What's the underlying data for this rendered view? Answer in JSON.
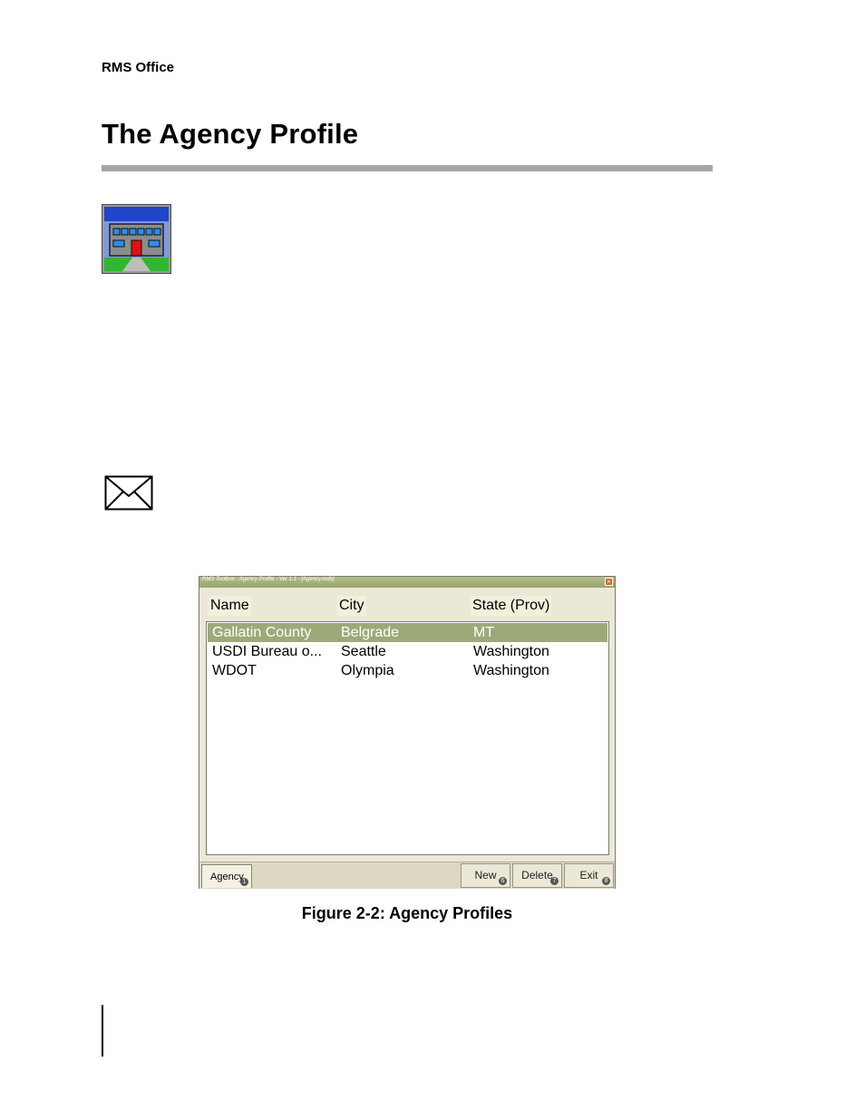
{
  "header": {
    "section": "RMS Office"
  },
  "page": {
    "title": "The Agency Profile"
  },
  "icons": {
    "agency": "building-icon",
    "note": "envelope-icon"
  },
  "window": {
    "title": "RMS Toolbox - Agency Profile - Ver 1.1 - [Agency.mdb]",
    "columns": [
      "Name",
      "City",
      "State (Prov)"
    ],
    "rows": [
      {
        "name": "Gallatin County",
        "city": "Belgrade",
        "state": "MT",
        "selected": true
      },
      {
        "name": "USDI Bureau o...",
        "city": "Seattle",
        "state": "Washington",
        "selected": false
      },
      {
        "name": "WDOT",
        "city": "Olympia",
        "state": "Washington",
        "selected": false
      }
    ],
    "tab": {
      "label": "Agency",
      "hotkey": "1"
    },
    "buttons": [
      {
        "label": "New",
        "hotkey": "6"
      },
      {
        "label": "Delete",
        "hotkey": "7"
      },
      {
        "label": "Exit",
        "hotkey": "8"
      }
    ],
    "colors": {
      "titlebar": "#98a56c",
      "selection": "#9caa78",
      "chrome": "#ece8d8"
    }
  },
  "figure": {
    "caption": "Figure 2-2: Agency Profiles"
  }
}
